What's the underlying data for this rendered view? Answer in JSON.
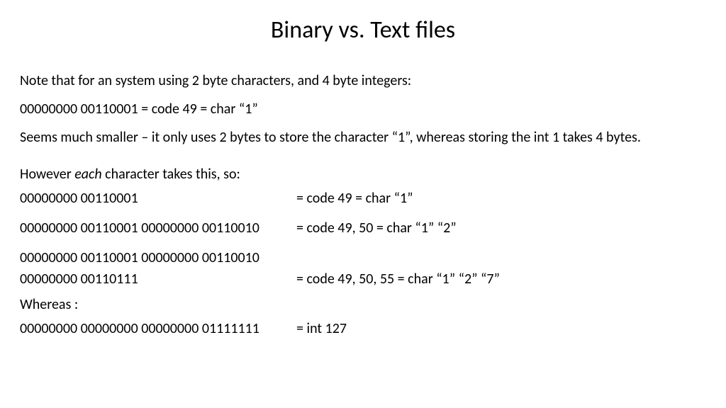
{
  "title": "Binary vs. Text files",
  "p1": "Note that for an system using 2 byte characters, and 4 byte integers:",
  "p2": "00000000 00110001 =  code 49  = char  “1”",
  "p3": "Seems much smaller – it only uses 2 bytes to store the character “1”, whereas storing the int 1 takes 4 bytes.",
  "p4_pre": "However ",
  "p4_em": "each",
  "p4_post": " character takes this, so:",
  "r1_bin": "00000000 00110001",
  "r1_eq": "=  code 49  = char  “1”",
  "r2_bin": "00000000 00110001 00000000 00110010",
  "r2_eq": "=  code 49, 50  = char  “1” “2”",
  "r3a_bin": "00000000 00110001 00000000 00110010",
  "r3b_bin": "00000000 00110111",
  "r3_eq": "= code 49, 50, 55  = char  “1” “2” “7”",
  "p5": "Whereas :",
  "r4_bin": "00000000 00000000 00000000 01111111",
  "r4_eq": "= int 127"
}
